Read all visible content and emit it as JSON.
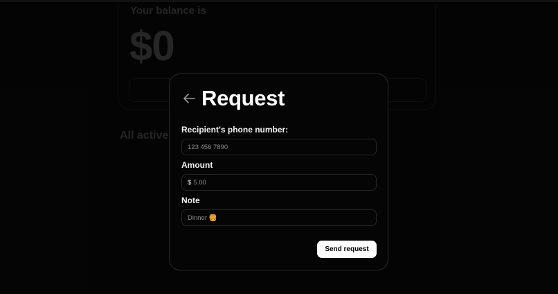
{
  "background": {
    "balance_label": "Your balance is",
    "balance_amount": "$0",
    "transactions_title": "All active t"
  },
  "modal": {
    "title": "Request",
    "back_icon": "arrow-left-icon",
    "fields": {
      "phone": {
        "label": "Recipient's phone number:",
        "placeholder": "123 456 7890",
        "value": ""
      },
      "amount": {
        "label": "Amount",
        "currency": "$",
        "placeholder": "5.00",
        "value": ""
      },
      "note": {
        "label": "Note",
        "placeholder": "Dinner 🍔",
        "value": ""
      }
    },
    "submit_label": "Send request"
  },
  "colors": {
    "background": "#070707",
    "modal_bg": "#050505",
    "button_bg": "#ffffff",
    "button_text": "#000000"
  }
}
